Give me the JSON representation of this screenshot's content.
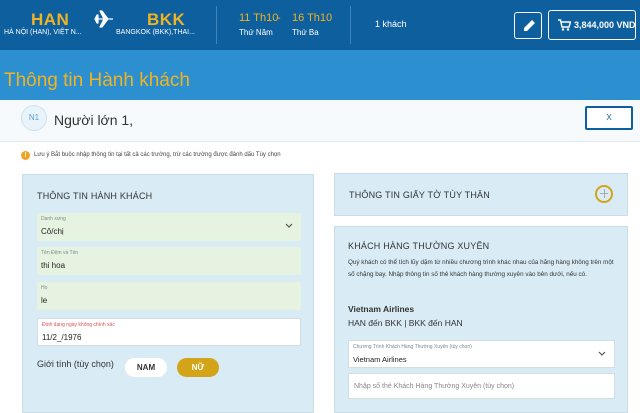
{
  "header": {
    "origin_code": "HAN",
    "origin_name": "HÀ NỘI (HAN), VIỆT N...",
    "destination_code": "BKK",
    "destination_name": "BANGKOK (BKK),THAI...",
    "depart_date": "11 Th10",
    "depart_day": "Thứ Năm",
    "return_date": "16 Th10",
    "return_day": "Thứ Ba",
    "passenger_count": "1 khách",
    "cart_total": "3,844,000 VND",
    "accent_color": "#f0b323",
    "bar_color": "#0d5f9e"
  },
  "page": {
    "title": "Thông tin Hành khách"
  },
  "passenger": {
    "badge": "N1",
    "title": "Người lớn 1,",
    "close_label": "X",
    "notice": "Lưu ý   Bắt buộc nhập thông tin tại tất cả các trường, trừ các trường được đánh dấu Tùy chọn"
  },
  "form": {
    "section_title": "THÔNG TIN HÀNH KHÁCH",
    "title_field": {
      "label": "Danh xưng",
      "value": "Cô/chị"
    },
    "given_name_field": {
      "label": "Tên Đệm và Tên",
      "value": "thi hoa"
    },
    "surname_field": {
      "label": "Họ",
      "value": "le"
    },
    "dob_field": {
      "label": "Định dạng ngày không chính xác",
      "value": "11/2_/1976"
    },
    "gender_label": "Giới tính (tùy chọn)",
    "gender_male": "NAM",
    "gender_female": "NỮ",
    "gender_selected": "NỮ"
  },
  "id_docs": {
    "title": "THÔNG TIN GIẤY TỜ TÙY THÂN"
  },
  "frequent_flyer": {
    "title": "KHÁCH HÀNG THƯỜNG XUYÊN",
    "description": "Quý khách có thể tích lũy dặm từ nhiều chương trình khác nhau của hãng hàng không trên một số chặng bay. Nhập thông tin số thẻ khách hàng thường xuyên vào bên dưới, nếu có.",
    "airline": "Vietnam Airlines",
    "legs": "HAN đến BKK | BKK đến HAN",
    "program_label": "Chương Trình Khách Hàng Thường Xuyên (tùy chọn)",
    "program_value": "Vietnam Airlines",
    "number_placeholder": "Nhập số thẻ Khách Hàng Thường Xuyên (tùy chọn)"
  }
}
